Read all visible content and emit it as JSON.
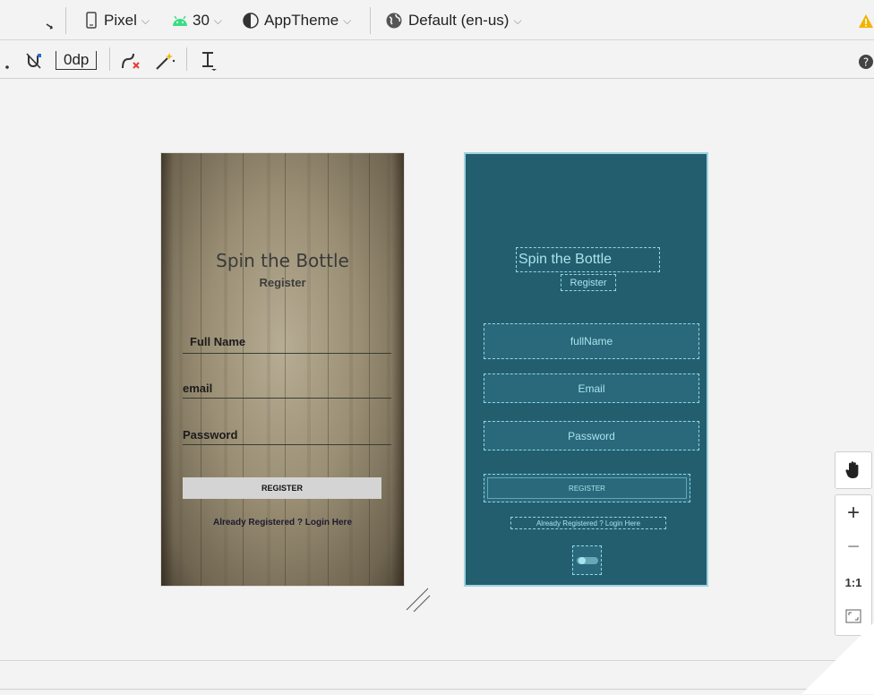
{
  "toolbar": {
    "device": "Pixel",
    "api_level": "30",
    "theme": "AppTheme",
    "locale": "Default (en-us)",
    "margin": "0dp"
  },
  "design": {
    "title": "Spin the Bottle",
    "subtitle": "Register",
    "labels": [
      "Full Name",
      "email",
      "Password"
    ],
    "button": "REGISTER",
    "link": "Already Registered ? Login Here"
  },
  "blueprint": {
    "title": "Spin the Bottle",
    "subtitle": "Register",
    "hints": [
      "fullName",
      "Email",
      "Password"
    ],
    "button": "REGISTER",
    "link": "Already Registered ? Login Here"
  },
  "zoom": {
    "plus": "+",
    "minus": "−",
    "one_to_one": "1:1"
  },
  "colors": {
    "blueprint_bg": "#235e6f",
    "blueprint_line": "#8fd8e6",
    "warning": "#f2b400",
    "android_green": "#3ddc84"
  }
}
